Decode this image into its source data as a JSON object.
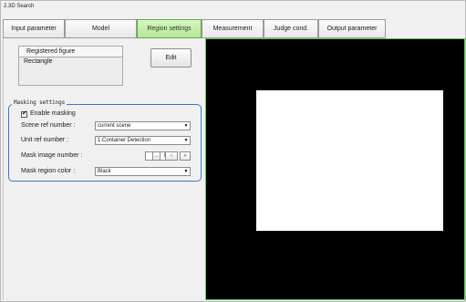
{
  "window": {
    "title": "2.3D Search"
  },
  "tabs": [
    {
      "label": "Input parameter",
      "active": false
    },
    {
      "label": "Model",
      "active": false
    },
    {
      "label": "Region settings",
      "active": true
    },
    {
      "label": "Measurement",
      "active": false
    },
    {
      "label": "Judge cond.",
      "active": false
    },
    {
      "label": "Output parameter",
      "active": false
    }
  ],
  "registered_figure": {
    "header": "Registered figure",
    "items": [
      "Rectangle"
    ]
  },
  "edit_button": {
    "label": "Edit"
  },
  "masking": {
    "legend": "Masking settings",
    "enable_label": "Enable masking",
    "enable_checked": true,
    "scene_ref": {
      "label": "Scene ref number :",
      "value": "current scene"
    },
    "unit_ref": {
      "label": "Unit ref number :",
      "value": "1.Container Detection"
    },
    "mask_image": {
      "label": "Mask image number :",
      "value": "0",
      "browse_label": "...",
      "prev_label": "<",
      "next_label": ">"
    },
    "mask_color": {
      "label": "Mask region color :",
      "value": "Black"
    }
  },
  "display": {
    "background_color": "#000000",
    "region_color": "#ffffff"
  },
  "colors": {
    "active_tab": "#b6e59a",
    "group_border": "#3b78c8",
    "display_border": "#67c35a"
  }
}
